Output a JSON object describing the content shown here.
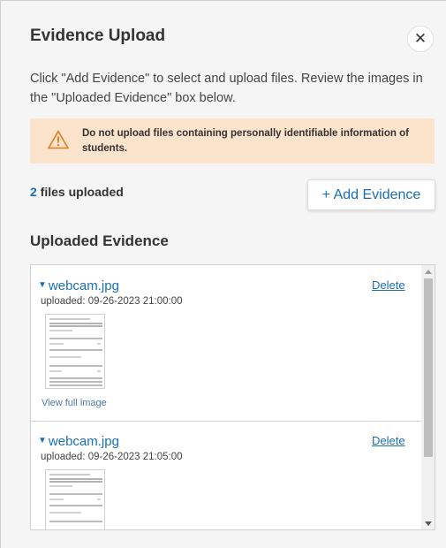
{
  "dialog": {
    "title": "Evidence Upload",
    "close_icon": "close-icon",
    "intro_text": "Click \"Add Evidence\" to select and upload files. Review the images in the \"Uploaded Evidence\" box below."
  },
  "warning": {
    "icon": "warning-triangle-icon",
    "text": "Do not upload files containing personally identifiable information of students.",
    "colors": {
      "background": "#fbe3cc",
      "icon": "#e07a1f"
    }
  },
  "files": {
    "count": "2",
    "count_label": " files uploaded",
    "add_button_label": "+ Add Evidence"
  },
  "uploaded_evidence": {
    "title": "Uploaded Evidence",
    "items": [
      {
        "name": "webcam.jpg",
        "uploaded": "uploaded: 09-26-2023 21:00:00",
        "delete_label": "Delete",
        "view_label": "View full image"
      },
      {
        "name": "webcam.jpg",
        "uploaded": "uploaded: 09-26-2023 21:05:00",
        "delete_label": "Delete"
      }
    ]
  },
  "colors": {
    "link": "#1a6fb5",
    "panel_bg": "#f5f5f5"
  }
}
